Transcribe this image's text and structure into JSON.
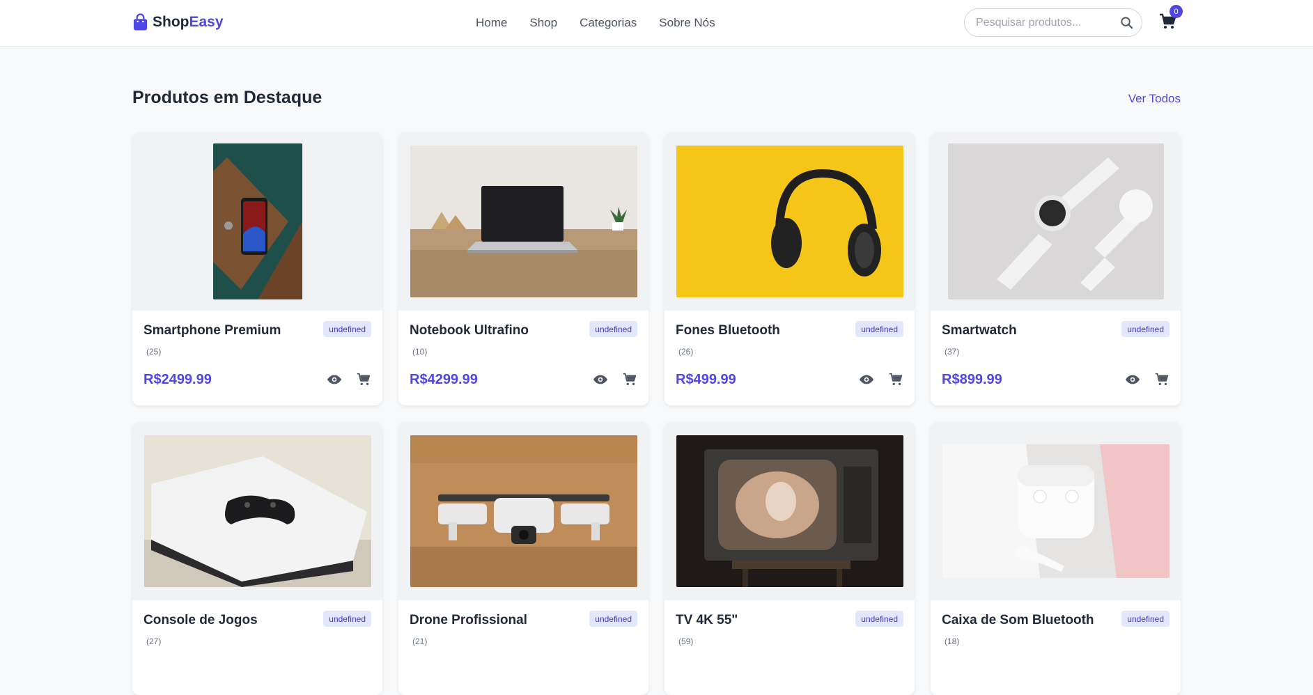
{
  "brand": {
    "part1": "Shop",
    "part2": "Easy"
  },
  "nav": {
    "links": [
      "Home",
      "Shop",
      "Categorias",
      "Sobre Nós"
    ]
  },
  "search": {
    "placeholder": "Pesquisar produtos..."
  },
  "cart": {
    "count": "0"
  },
  "section": {
    "title": "Produtos em Destaque",
    "view_all": "Ver Todos"
  },
  "products": [
    {
      "name": "Smartphone Premium",
      "badge": "undefined",
      "rating": "(25)",
      "price": "R$2499.99",
      "image": "smartphone-photo"
    },
    {
      "name": "Notebook Ultrafino",
      "badge": "undefined",
      "rating": "(10)",
      "price": "R$4299.99",
      "image": "laptop-photo"
    },
    {
      "name": "Fones Bluetooth",
      "badge": "undefined",
      "rating": "(26)",
      "price": "R$499.99",
      "image": "headphones-photo"
    },
    {
      "name": "Smartwatch",
      "badge": "undefined",
      "rating": "(37)",
      "price": "R$899.99",
      "image": "smartwatch-photo"
    },
    {
      "name": "Console de Jogos",
      "badge": "undefined",
      "rating": "(27)",
      "price": "",
      "image": "console-photo"
    },
    {
      "name": "Drone Profissional",
      "badge": "undefined",
      "rating": "(21)",
      "price": "",
      "image": "drone-photo"
    },
    {
      "name": "TV 4K 55\"",
      "badge": "undefined",
      "rating": "(59)",
      "price": "",
      "image": "tv-photo"
    },
    {
      "name": "Caixa de Som Bluetooth",
      "badge": "undefined",
      "rating": "(18)",
      "price": "",
      "image": "earbuds-photo"
    }
  ],
  "icons": {
    "view": "eye-icon",
    "cart": "cart-icon",
    "search": "search-icon",
    "brand": "shopping-bag-icon"
  },
  "colors": {
    "accent": "#4f46e5",
    "badge_bg": "#e0e7ff",
    "page_bg": "#f8f9fb"
  }
}
